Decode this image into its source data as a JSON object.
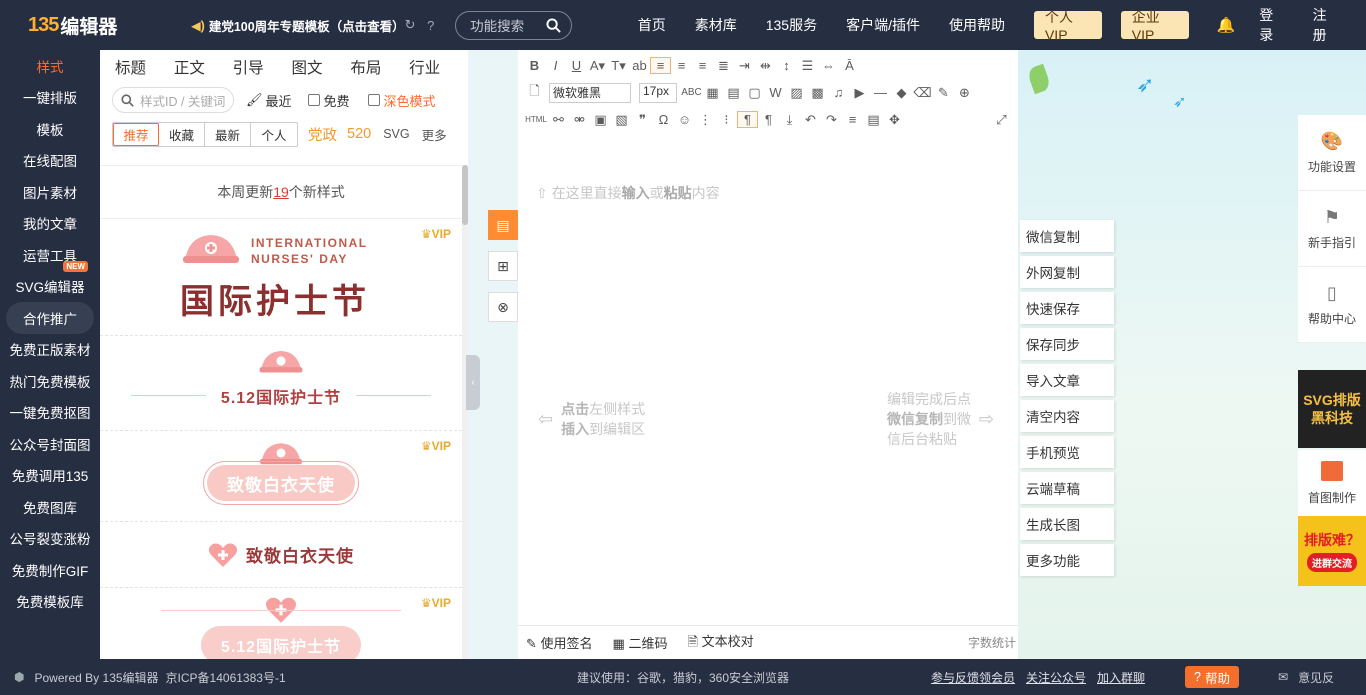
{
  "header": {
    "logo_mark": "135",
    "logo_text": "编辑器",
    "notice": "建党100周年专题模板（点击查看）",
    "search_placeholder": "功能搜索",
    "nav": [
      "首页",
      "素材库",
      "135服务",
      "客户端/插件",
      "使用帮助"
    ],
    "vip_personal": "个人VIP",
    "vip_enterprise": "企业VIP",
    "login": "登录",
    "register": "注册"
  },
  "left_nav": {
    "items": [
      "样式",
      "一键排版",
      "模板",
      "在线配图",
      "图片素材",
      "我的文章",
      "运营工具",
      "SVG编辑器",
      "合作推广",
      "免费正版素材",
      "热门免费模板",
      "一键免费抠图",
      "公众号封面图",
      "免费调用135",
      "免费图库",
      "公号裂变涨粉",
      "免费制作GIF",
      "免费模板库"
    ],
    "new_badge": "NEW"
  },
  "style_panel": {
    "category_tabs": [
      "标题",
      "正文",
      "引导",
      "图文",
      "布局",
      "行业"
    ],
    "search_placeholder": "样式ID / 关键词",
    "recent_label": "最近",
    "free_label": "免费",
    "dark_label": "深色模式",
    "sub_tabs": [
      "推荐",
      "收藏",
      "最新",
      "个人"
    ],
    "tag_party": "党政",
    "tag_520": "520",
    "tag_svg": "SVG",
    "tag_more": "更多",
    "week_prefix": "本周更新",
    "week_count": "19",
    "week_suffix": "个新样式",
    "vip_label": "VIP",
    "cards": {
      "card1_en_line1": "INTERNATIONAL",
      "card1_en_line2": "NURSES' DAY",
      "card1_cn": "国际护士节",
      "card2": "5.12国际护士节",
      "card3": "致敬白衣天使",
      "card4": "致敬白衣天使",
      "card5": "5.12国际护士节"
    }
  },
  "editor": {
    "font_family": "微软雅黑",
    "font_size": "17px",
    "html_label": "HTML",
    "placeholder_pre": "在这里直接",
    "placeholder_b1": "输入",
    "placeholder_mid": "或",
    "placeholder_b2": "粘贴",
    "placeholder_post": "内容",
    "hint_left_b1": "点击",
    "hint_left_t1": "左侧样式",
    "hint_left_b2": "插入",
    "hint_left_t2": "到编辑区",
    "hint_right_t1": "编辑完成后点",
    "hint_right_b": "微信复制",
    "hint_right_t2": "到微",
    "hint_right_t3": "信后台粘贴",
    "footer_sign": "使用签名",
    "footer_qr": "二维码",
    "footer_proof": "文本校对",
    "footer_count": "字数统计"
  },
  "actions": [
    "微信复制",
    "外网复制",
    "快速保存",
    "保存同步",
    "导入文章",
    "清空内容",
    "手机预览",
    "云端草稿",
    "生成长图",
    "更多功能"
  ],
  "right_side": {
    "settings": "功能设置",
    "guide": "新手指引",
    "help_center": "帮助中心",
    "svg_line1": "SVG排版",
    "svg_line2": "黑科技",
    "cover": "首图制作",
    "paiban_title": "排版难？",
    "paiban_btn": "进群交流"
  },
  "footer": {
    "powered": "Powered By 135编辑器",
    "icp": "京ICP备14061383号-1",
    "suggest": "建议使用：谷歌，猎豹，360安全浏览器",
    "feedback": "参与反馈领会员",
    "follow": "关注公众号",
    "group": "加入群聊",
    "help": "帮助",
    "opinion": "意见反"
  },
  "colors": {
    "topbar": "#262e42",
    "accent": "#ff6a2b",
    "vip_bg": "#fbe5b5",
    "card_red": "#9a3a3a"
  }
}
